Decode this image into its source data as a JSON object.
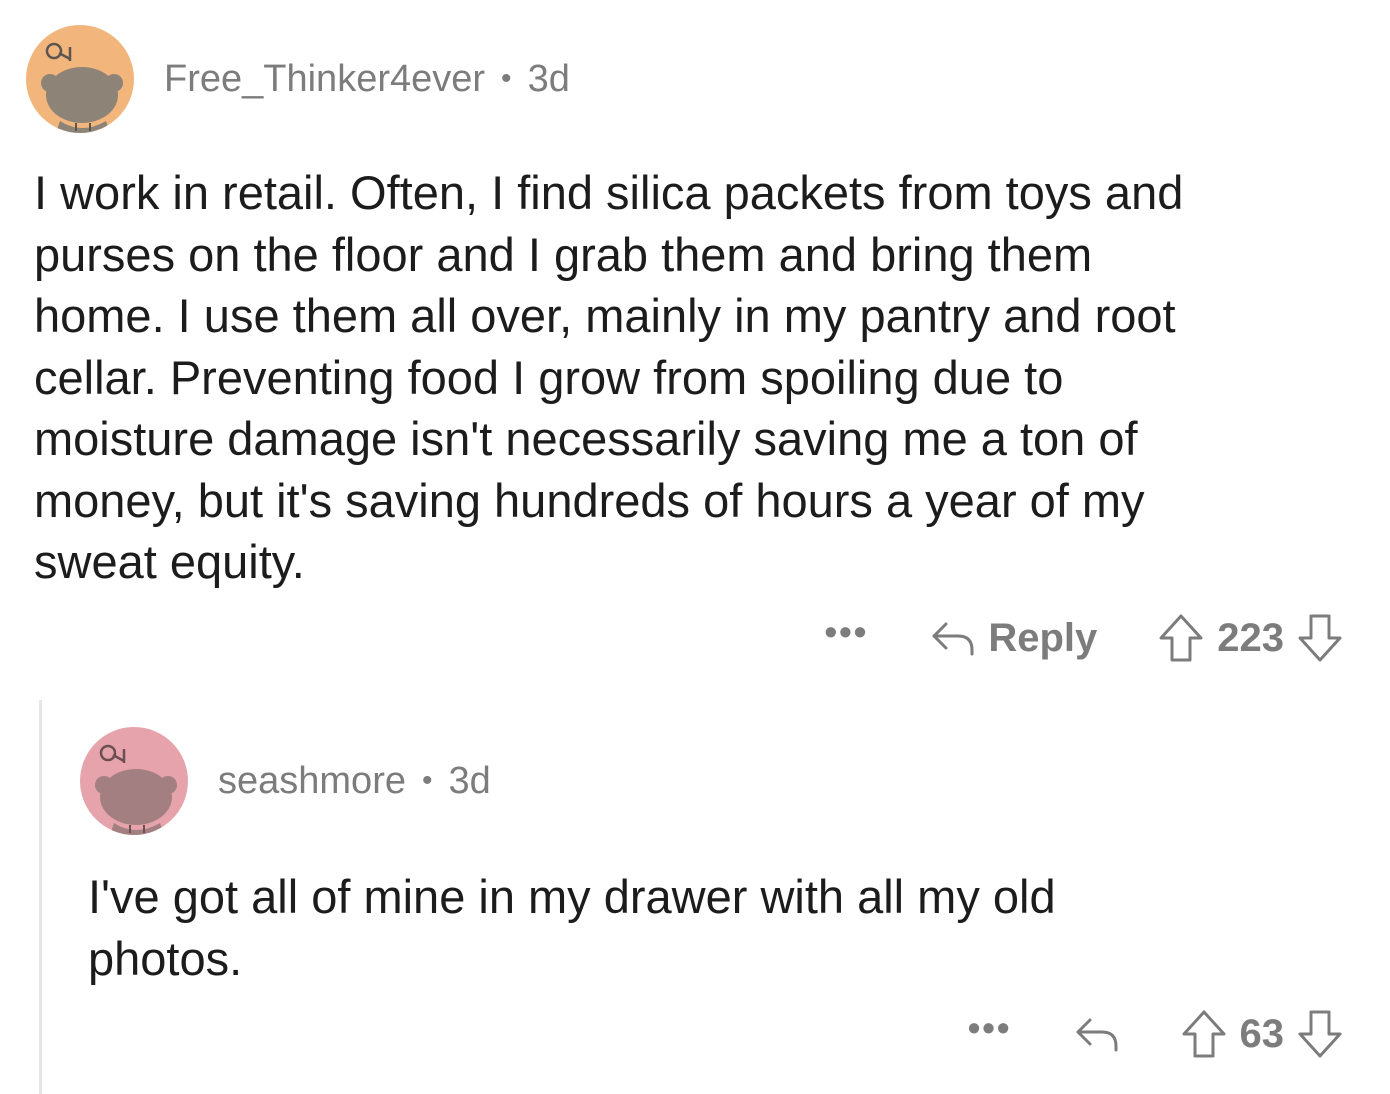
{
  "comments": [
    {
      "username": "Free_Thinker4ever",
      "age": "3d",
      "avatar_color": "#f2b57c",
      "body": "I work in retail. Often, I find silica packets from toys and\npurses on the floor and I grab them and bring them\nhome. I use them all over, mainly in my pantry and root\ncellar. Preventing food I grow from spoiling due to\nmoisture damage isn't necessarily saving me a ton of\nmoney, but it's saving hundreds of hours a year of my\nsweat equity.",
      "more_label": "•••",
      "reply_label": "Reply",
      "score": "223"
    },
    {
      "username": "seashmore",
      "age": "3d",
      "avatar_color": "#e6a3ac",
      "body": "I've got all of mine in my drawer with all my old\nphotos.",
      "more_label": "•••",
      "score": "63"
    }
  ],
  "separator": "•",
  "colors": {
    "meta": "#7c7c7c",
    "text": "#1c1c1c",
    "thread_line": "#e6e6e6"
  }
}
